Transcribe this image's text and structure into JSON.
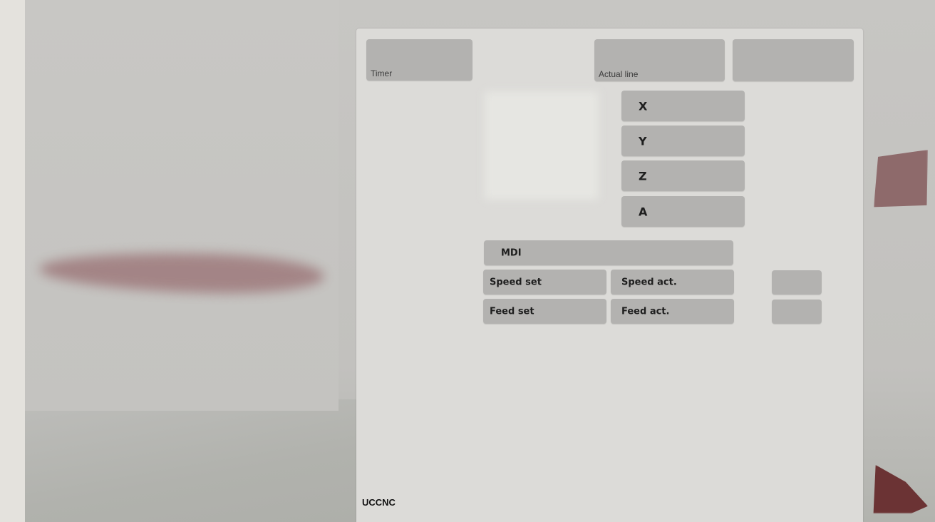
{
  "header": {
    "timer_label": "Timer",
    "actual_line_label": "Actual line"
  },
  "axes": {
    "x": "X",
    "y": "Y",
    "z": "Z",
    "a": "A"
  },
  "mdi": {
    "label": "MDI"
  },
  "speed": {
    "set_label": "Speed set",
    "act_label": "Speed act."
  },
  "feed": {
    "set_label": "Feed set",
    "act_label": "Feed act."
  },
  "brand": {
    "name": "UCCNC"
  },
  "colors": {
    "panel": "#dcdbd8",
    "field": "#b3b2b0",
    "accent": "#6b3334"
  }
}
